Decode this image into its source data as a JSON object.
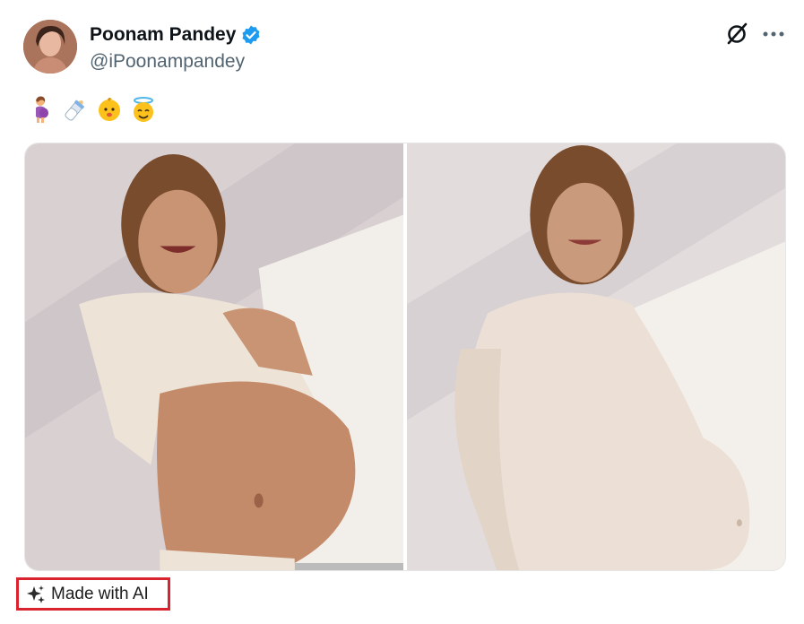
{
  "post": {
    "author": {
      "display_name": "Poonam Pandey",
      "handle": "@iPoonampandey",
      "verified": true
    },
    "emojis": [
      "🤰",
      "🍼",
      "👶",
      "😇"
    ],
    "media_count": 2,
    "label": "Made with AI"
  },
  "icons": {
    "verified": "verified-badge-icon",
    "grok": "grok-icon",
    "more": "more-options-icon",
    "sparkle": "sparkle-icon"
  },
  "colors": {
    "verified_blue": "#1d9bf0",
    "handle_gray": "#536471",
    "highlight_red": "#d9232e"
  }
}
